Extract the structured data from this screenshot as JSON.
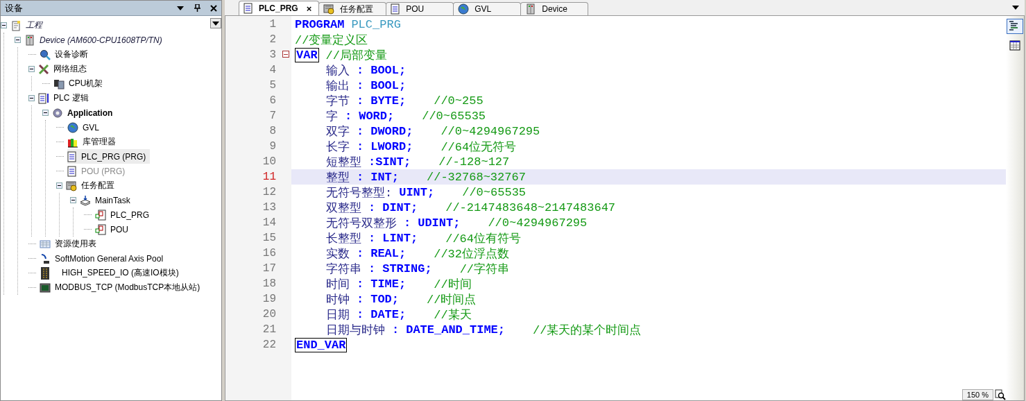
{
  "sidebar": {
    "title": "设备",
    "tree": [
      {
        "label": "工程",
        "kind": "project",
        "selected": false,
        "disabled": false,
        "expanded": true,
        "children": [
          {
            "label": "Device (AM600-CPU1608TP/TN)",
            "kind": "device",
            "selected": false,
            "disabled": false,
            "expanded": true,
            "children": [
              {
                "label": "设备诊断",
                "kind": "diagnosis",
                "selected": false,
                "disabled": false
              },
              {
                "label": "网络组态",
                "kind": "network",
                "selected": false,
                "disabled": false,
                "expanded": true,
                "children": [
                  {
                    "label": "CPU机架",
                    "kind": "rack",
                    "selected": false,
                    "disabled": false
                  }
                ]
              },
              {
                "label": "PLC 逻辑",
                "kind": "logic",
                "selected": false,
                "disabled": false,
                "expanded": true,
                "children": [
                  {
                    "label": "Application",
                    "kind": "application",
                    "selected": false,
                    "disabled": false,
                    "expanded": true,
                    "children": [
                      {
                        "label": "GVL",
                        "kind": "gvl",
                        "selected": false,
                        "disabled": false
                      },
                      {
                        "label": "库管理器",
                        "kind": "library",
                        "selected": false,
                        "disabled": false
                      },
                      {
                        "label": "PLC_PRG (PRG)",
                        "kind": "pou",
                        "selected": true,
                        "disabled": false
                      },
                      {
                        "label": "POU (PRG)",
                        "kind": "pou",
                        "selected": false,
                        "disabled": true
                      },
                      {
                        "label": "任务配置",
                        "kind": "taskconfig",
                        "selected": false,
                        "disabled": false,
                        "expanded": true,
                        "children": [
                          {
                            "label": "MainTask",
                            "kind": "task",
                            "selected": false,
                            "disabled": false,
                            "expanded": true,
                            "children": [
                              {
                                "label": "PLC_PRG",
                                "kind": "call",
                                "selected": false,
                                "disabled": false
                              },
                              {
                                "label": "POU",
                                "kind": "call",
                                "selected": false,
                                "disabled": false
                              }
                            ]
                          }
                        ]
                      }
                    ]
                  }
                ]
              },
              {
                "label": "资源使用表",
                "kind": "resource",
                "selected": false,
                "disabled": false
              },
              {
                "label": "SoftMotion General Axis Pool",
                "kind": "axis",
                "selected": false,
                "disabled": false
              },
              {
                "label": "HIGH_SPEED_IO (高速IO模块)",
                "kind": "io",
                "selected": false,
                "disabled": false
              },
              {
                "label": "MODBUS_TCP (ModbusTCP本地从站)",
                "kind": "modbus",
                "selected": false,
                "disabled": false
              }
            ]
          }
        ]
      }
    ]
  },
  "tabs": [
    {
      "label": "PLC_PRG",
      "kind": "pou",
      "selected": true,
      "close": "×"
    },
    {
      "label": "任务配置",
      "kind": "taskconfig",
      "selected": false
    },
    {
      "label": "POU",
      "kind": "pou",
      "selected": false
    },
    {
      "label": "GVL",
      "kind": "gvl",
      "selected": false
    },
    {
      "label": "Device",
      "kind": "device",
      "selected": false
    }
  ],
  "editor": {
    "lines": [
      {
        "number": "1",
        "highlighted": false,
        "tokens": [
          {
            "kind": "keyword",
            "text": "PROGRAM"
          },
          {
            "kind": "ident",
            "text": "PLC_PRG"
          }
        ]
      },
      {
        "number": "2",
        "highlighted": false,
        "tokens": [
          {
            "kind": "comment",
            "text": "//变量定义区"
          }
        ]
      },
      {
        "number": "3",
        "highlighted": false,
        "fold": true,
        "tokens": [
          {
            "kind": "boxed",
            "text": "VAR"
          },
          {
            "kind": "comment",
            "text": "//局部变量"
          }
        ]
      },
      {
        "number": "4",
        "highlighted": false,
        "tokens": [
          {
            "kind": "name",
            "text": "输入"
          },
          {
            "kind": "colon",
            "text": ":"
          },
          {
            "kind": "type",
            "text": "BOOL;"
          }
        ]
      },
      {
        "number": "5",
        "highlighted": false,
        "tokens": [
          {
            "kind": "name",
            "text": "输出"
          },
          {
            "kind": "colon",
            "text": ":"
          },
          {
            "kind": "type",
            "text": "BOOL;"
          }
        ]
      },
      {
        "number": "6",
        "highlighted": false,
        "tokens": [
          {
            "kind": "name",
            "text": "字节"
          },
          {
            "kind": "colon",
            "text": ":"
          },
          {
            "kind": "type",
            "text": "BYTE;"
          },
          {
            "kind": "comment",
            "text": "//0~255"
          }
        ]
      },
      {
        "number": "7",
        "highlighted": false,
        "tokens": [
          {
            "kind": "name",
            "text": "字"
          },
          {
            "kind": "colon",
            "text": ":"
          },
          {
            "kind": "type",
            "text": "WORD;"
          },
          {
            "kind": "comment",
            "text": "//0~65535"
          }
        ]
      },
      {
        "number": "8",
        "highlighted": false,
        "tokens": [
          {
            "kind": "name",
            "text": "双字"
          },
          {
            "kind": "colon",
            "text": ":"
          },
          {
            "kind": "type",
            "text": "DWORD;"
          },
          {
            "kind": "comment",
            "text": "//0~4294967295"
          }
        ]
      },
      {
        "number": "9",
        "highlighted": false,
        "tokens": [
          {
            "kind": "name",
            "text": "长字"
          },
          {
            "kind": "colon",
            "text": ":"
          },
          {
            "kind": "type",
            "text": "LWORD;"
          },
          {
            "kind": "comment",
            "text": "//64位无符号"
          }
        ]
      },
      {
        "number": "10",
        "highlighted": false,
        "tokens": [
          {
            "kind": "name",
            "text": "短整型"
          },
          {
            "kind": "type",
            "text": ":SINT;"
          },
          {
            "kind": "comment",
            "text": "//-128~127"
          }
        ]
      },
      {
        "number": "11",
        "highlighted": true,
        "tokens": [
          {
            "kind": "name",
            "text": "整型"
          },
          {
            "kind": "colon",
            "text": ":"
          },
          {
            "kind": "type",
            "text": "INT;"
          },
          {
            "kind": "comment",
            "text": "//-32768~32767"
          }
        ]
      },
      {
        "number": "12",
        "highlighted": false,
        "tokens": [
          {
            "kind": "name",
            "text": "无符号整型:"
          },
          {
            "kind": "type",
            "text": "UINT;"
          },
          {
            "kind": "comment",
            "text": "//0~65535"
          }
        ]
      },
      {
        "number": "13",
        "highlighted": false,
        "tokens": [
          {
            "kind": "name",
            "text": "双整型"
          },
          {
            "kind": "colon",
            "text": ":"
          },
          {
            "kind": "type",
            "text": "DINT;"
          },
          {
            "kind": "comment",
            "text": "//-2147483648~2147483647"
          }
        ]
      },
      {
        "number": "14",
        "highlighted": false,
        "tokens": [
          {
            "kind": "name",
            "text": "无符号双整形"
          },
          {
            "kind": "colon",
            "text": ":"
          },
          {
            "kind": "type",
            "text": "UDINT;"
          },
          {
            "kind": "comment",
            "text": "//0~4294967295"
          }
        ]
      },
      {
        "number": "15",
        "highlighted": false,
        "tokens": [
          {
            "kind": "name",
            "text": "长整型"
          },
          {
            "kind": "colon",
            "text": ":"
          },
          {
            "kind": "type",
            "text": "LINT;"
          },
          {
            "kind": "comment",
            "text": "//64位有符号"
          }
        ]
      },
      {
        "number": "16",
        "highlighted": false,
        "tokens": [
          {
            "kind": "name",
            "text": "实数"
          },
          {
            "kind": "colon",
            "text": ":"
          },
          {
            "kind": "type",
            "text": "REAL;"
          },
          {
            "kind": "comment",
            "text": "//32位浮点数"
          }
        ]
      },
      {
        "number": "17",
        "highlighted": false,
        "tokens": [
          {
            "kind": "name",
            "text": "字符串"
          },
          {
            "kind": "colon",
            "text": ":"
          },
          {
            "kind": "type",
            "text": "STRING;"
          },
          {
            "kind": "comment",
            "text": "//字符串"
          }
        ]
      },
      {
        "number": "18",
        "highlighted": false,
        "tokens": [
          {
            "kind": "name",
            "text": "时间"
          },
          {
            "kind": "colon",
            "text": ":"
          },
          {
            "kind": "type",
            "text": "TIME;"
          },
          {
            "kind": "comment",
            "text": "//时间"
          }
        ]
      },
      {
        "number": "19",
        "highlighted": false,
        "tokens": [
          {
            "kind": "name",
            "text": "时钟"
          },
          {
            "kind": "colon",
            "text": ":"
          },
          {
            "kind": "type",
            "text": "TOD;"
          },
          {
            "kind": "comment",
            "text": "//时间点"
          }
        ]
      },
      {
        "number": "20",
        "highlighted": false,
        "tokens": [
          {
            "kind": "name",
            "text": "日期"
          },
          {
            "kind": "colon",
            "text": ":"
          },
          {
            "kind": "type",
            "text": "DATE;"
          },
          {
            "kind": "comment",
            "text": "//某天"
          }
        ]
      },
      {
        "number": "21",
        "highlighted": false,
        "tokens": [
          {
            "kind": "name",
            "text": "日期与时钟"
          },
          {
            "kind": "colon",
            "text": ":"
          },
          {
            "kind": "type",
            "text": "DATE_AND_TIME;"
          },
          {
            "kind": "comment",
            "text": "//某天的某个时间点"
          }
        ]
      },
      {
        "number": "22",
        "highlighted": false,
        "tokens": [
          {
            "kind": "boxed",
            "text": "END_VAR"
          }
        ]
      }
    ]
  },
  "zoom": "150 %"
}
